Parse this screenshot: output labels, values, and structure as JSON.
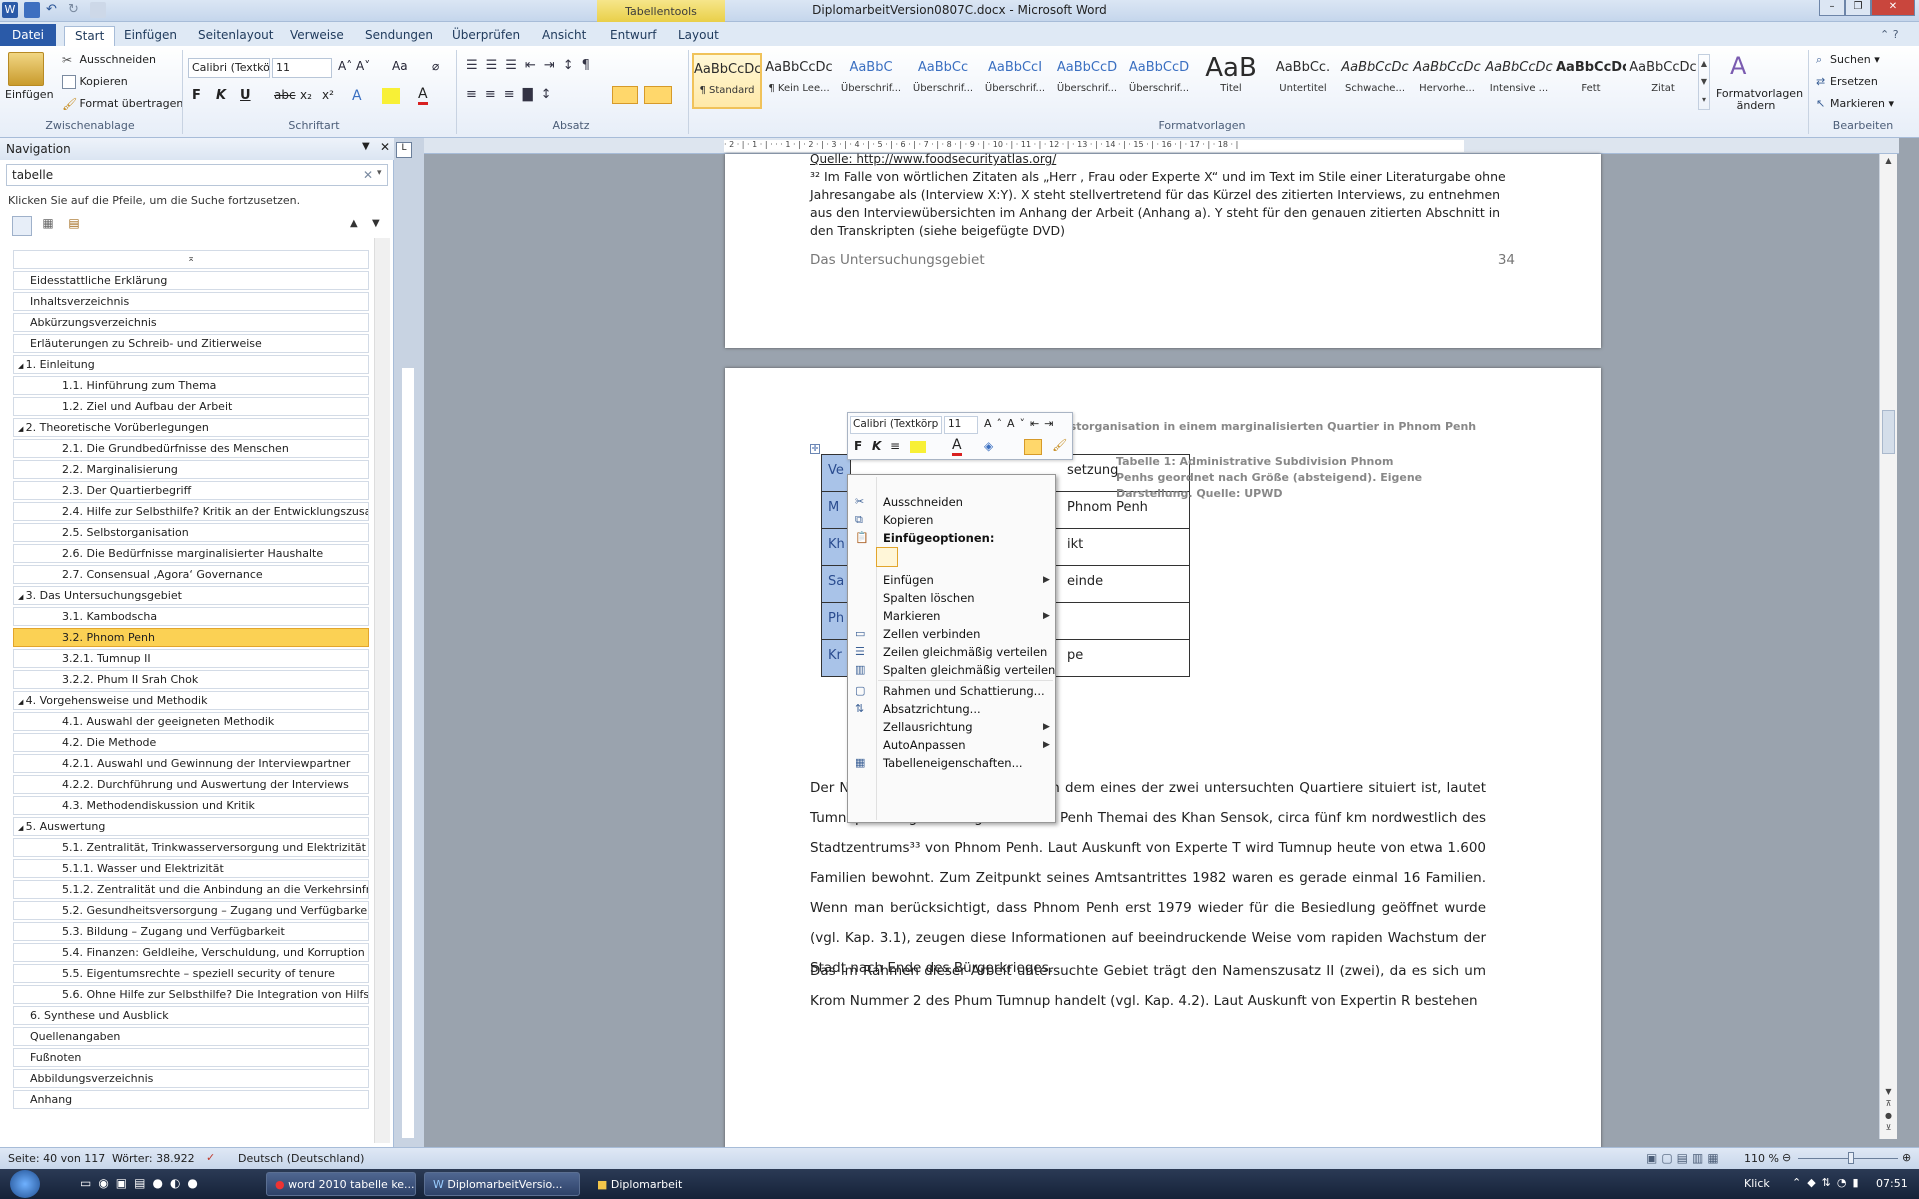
{
  "window": {
    "title": "DiplomarbeitVersion0807C.docx - Microsoft Word",
    "context_group": "Tabellentools"
  },
  "tabs": [
    "Datei",
    "Start",
    "Einfügen",
    "Seitenlayout",
    "Verweise",
    "Sendungen",
    "Überprüfen",
    "Ansicht",
    "Entwurf",
    "Layout"
  ],
  "ribbon": {
    "clipboard": {
      "paste": "Einfügen",
      "cut": "Ausschneiden",
      "copy": "Kopieren",
      "format": "Format übertragen",
      "label": "Zwischenablage"
    },
    "font": {
      "family": "Calibri (Textkö",
      "size": "11",
      "label": "Schriftart"
    },
    "paragraph": {
      "label": "Absatz"
    },
    "styles": {
      "label": "Formatvorlagen",
      "items": [
        {
          "sample": "AaBbCcDc",
          "name": "¶ Standard"
        },
        {
          "sample": "AaBbCcDc",
          "name": "¶ Kein Lee..."
        },
        {
          "sample": "AaBbC",
          "name": "Überschrif..."
        },
        {
          "sample": "AaBbCc",
          "name": "Überschrif..."
        },
        {
          "sample": "AaBbCcI",
          "name": "Überschrif..."
        },
        {
          "sample": "AaBbCcD",
          "name": "Überschrif..."
        },
        {
          "sample": "AaBbCcD",
          "name": "Überschrif..."
        },
        {
          "sample": "AaB",
          "name": "Titel"
        },
        {
          "sample": "AaBbCc.",
          "name": "Untertitel"
        },
        {
          "sample": "AaBbCcDc",
          "name": "Schwache..."
        },
        {
          "sample": "AaBbCcDc",
          "name": "Hervorhe..."
        },
        {
          "sample": "AaBbCcDc",
          "name": "Intensive ..."
        },
        {
          "sample": "AaBbCcDc",
          "name": "Fett"
        },
        {
          "sample": "AaBbCcDc",
          "name": "Zitat"
        }
      ],
      "change": "Formatvorlagen ändern"
    },
    "editing": {
      "find": "Suchen",
      "replace": "Ersetzen",
      "select": "Markieren",
      "label": "Bearbeiten"
    }
  },
  "nav": {
    "title": "Navigation",
    "search": "tabelle",
    "hint": "Klicken Sie auf die Pfeile, um die Suche fortzusetzen.",
    "items": [
      {
        "t": "Eidesstattliche Erklärung",
        "lvl": 0
      },
      {
        "t": "Inhaltsverzeichnis",
        "lvl": 0
      },
      {
        "t": "Abkürzungsverzeichnis",
        "lvl": 0
      },
      {
        "t": "Erläuterungen zu Schreib- und Zitierweise",
        "lvl": 0
      },
      {
        "t": "1. Einleitung",
        "lvl": -1
      },
      {
        "t": "1.1. Hinführung zum Thema",
        "lvl": 1
      },
      {
        "t": "1.2. Ziel und Aufbau der Arbeit",
        "lvl": 1
      },
      {
        "t": "2. Theoretische Vorüberlegungen",
        "lvl": -1
      },
      {
        "t": "2.1. Die Grundbedürfnisse des Menschen",
        "lvl": 1
      },
      {
        "t": "2.2. Marginalisierung",
        "lvl": 1
      },
      {
        "t": "2.3. Der Quartierbegriff",
        "lvl": 1
      },
      {
        "t": "2.4. Hilfe zur Selbsthilfe? Kritik an der Entwicklungszusam...",
        "lvl": 1
      },
      {
        "t": "2.5. Selbstorganisation",
        "lvl": 1
      },
      {
        "t": "2.6. Die Bedürfnisse marginalisierter Haushalte",
        "lvl": 1
      },
      {
        "t": "2.7. Consensual ‚Agora‘ Governance",
        "lvl": 1
      },
      {
        "t": "3. Das Untersuchungsgebiet",
        "lvl": -1
      },
      {
        "t": "3.1. Kambodscha",
        "lvl": 1
      },
      {
        "t": "3.2. Phnom Penh",
        "lvl": 1,
        "sel": true
      },
      {
        "t": "3.2.1. Tumnup II",
        "lvl": 1
      },
      {
        "t": "3.2.2. Phum II Srah Chok",
        "lvl": 1
      },
      {
        "t": "4. Vorgehensweise und Methodik",
        "lvl": -1
      },
      {
        "t": "4.1. Auswahl der geeigneten Methodik",
        "lvl": 1
      },
      {
        "t": "4.2. Die Methode",
        "lvl": 1
      },
      {
        "t": "4.2.1. Auswahl und Gewinnung der Interviewpartner",
        "lvl": 1
      },
      {
        "t": "4.2.2. Durchführung und Auswertung der Interviews",
        "lvl": 1
      },
      {
        "t": "4.3. Methodendiskussion und Kritik",
        "lvl": 1
      },
      {
        "t": "5. Auswertung",
        "lvl": -1
      },
      {
        "t": "5.1. Zentralität, Trinkwasserversorgung und Elektrizität",
        "lvl": 1
      },
      {
        "t": "5.1.1. Wasser und Elektrizität",
        "lvl": 1
      },
      {
        "t": "5.1.2. Zentralität und die Anbindung an die Verkehrsinfra...",
        "lvl": 1
      },
      {
        "t": "5.2. Gesundheitsversorgung – Zugang und Verfügbarkeit",
        "lvl": 1
      },
      {
        "t": "5.3. Bildung – Zugang und Verfügbarkeit",
        "lvl": 1
      },
      {
        "t": "5.4. Finanzen: Geldleihe, Verschuldung, und Korruption",
        "lvl": 1
      },
      {
        "t": "5.5. Eigentumsrechte – speziell security of tenure",
        "lvl": 1
      },
      {
        "t": "5.6. Ohne Hilfe zur Selbsthilfe? Die Integration von Hilfso...",
        "lvl": 1
      },
      {
        "t": "6. Synthese und Ausblick",
        "lvl": 0
      },
      {
        "t": "Quellenangaben",
        "lvl": 0
      },
      {
        "t": "Fußnoten",
        "lvl": 0
      },
      {
        "t": "Abbildungsverzeichnis",
        "lvl": 0
      },
      {
        "t": "Anhang",
        "lvl": 0
      }
    ]
  },
  "page1": {
    "source_line": "Quelle: http://www.foodsecurityatlas.org/",
    "footnote": "³² Im Falle von wörtlichen Zitaten als „Herr , Frau oder Experte X“ und im Text im Stile einer Literaturgabe ohne Jahresangabe als (Interview X:Y). X steht stellvertretend für das Kürzel des zitierten Interviews, zu entnehmen aus den Interviewübersichten im Anhang der Arbeit (Anhang a). Y steht für den genauen zitierten Abschnitt in den Transkripten (siehe beigefügte DVD)",
    "footer_title": "Das Untersuchungsgebiet",
    "page_number": "34"
  },
  "page2": {
    "header": "n Selbstorganisation in einem marginalisierten Quartier in Phnom Penh",
    "caption": "Tabelle 1: Administrative Subdivision Phnom Penhs geordnet nach Größe (absteigend). Eigene Darstellung. Quelle: UPWD",
    "table_rows": [
      [
        "Ve",
        "setzung"
      ],
      [
        "M",
        "Phnom Penh"
      ],
      [
        "Kh",
        "ikt"
      ],
      [
        "Sa",
        "einde"
      ],
      [
        "Ph",
        ""
      ],
      [
        "Kr",
        "pe"
      ]
    ],
    "para1": "Der Name des Phum (vgl. Tab. 1), in dem eines der zwei untersuchten Quartiere situiert ist, lautet Tumnup. Es liegt im Sangkat Phnom Penh Themai des Khan Sensok, circa fünf km nordwestlich des Stadtzentrums³³ von Phnom Penh. Laut Auskunft von Experte T wird Tumnup heute von etwa 1.600 Familien bewohnt. Zum Zeitpunkt seines Amtsantrittes 1982 waren es gerade einmal 16 Familien. Wenn man berücksichtigt, dass Phnom Penh erst 1979 wieder für die Besiedlung geöffnet wurde (vgl. Kap. 3.1), zeugen diese Informationen auf beeindruckende Weise vom rapiden Wachstum der Stadt nach Ende des Bürgerkrieges.",
    "para2": "Das im Rahmen dieser Arbeit untersuchte Gebiet trägt den Namenszusatz II (zwei), da es sich um Krom Nummer 2 des Phum Tumnup handelt (vgl. Kap. 4.2). Laut Auskunft von Expertin R bestehen"
  },
  "minitoolbar": {
    "font": "Calibri (Textkörp",
    "size": "11"
  },
  "context_menu": [
    {
      "label": "Ausschneiden",
      "icon": "scissors-icon"
    },
    {
      "label": "Kopieren",
      "icon": "copy-icon"
    },
    {
      "label": "Einfügeoptionen:",
      "icon": "paste-icon",
      "bold": true
    },
    {
      "label": "Einfügen",
      "sub": true
    },
    {
      "label": "Spalten löschen"
    },
    {
      "label": "Markieren",
      "sub": true
    },
    {
      "label": "Zellen verbinden",
      "icon": "merge-icon"
    },
    {
      "label": "Zeilen gleichmäßig verteilen",
      "icon": "rows-icon"
    },
    {
      "label": "Spalten gleichmäßig verteilen",
      "icon": "cols-icon"
    },
    {
      "label": "Rahmen und Schattierung...",
      "icon": "border-icon"
    },
    {
      "label": "Absatzrichtung...",
      "icon": "direction-icon"
    },
    {
      "label": "Zellausrichtung",
      "sub": true
    },
    {
      "label": "AutoAnpassen",
      "sub": true
    },
    {
      "label": "Tabelleneigenschaften...",
      "icon": "table-icon"
    }
  ],
  "status": {
    "page": "Seite: 40 von 117",
    "words": "Wörter: 38.922",
    "lang": "Deutsch (Deutschland)",
    "zoom": "110 %"
  },
  "taskbar": {
    "items": [
      "word 2010 tabelle ke...",
      "DiplomarbeitVersio...",
      "Diplomarbeit"
    ],
    "mode": "Klick",
    "clock": "07:51"
  }
}
